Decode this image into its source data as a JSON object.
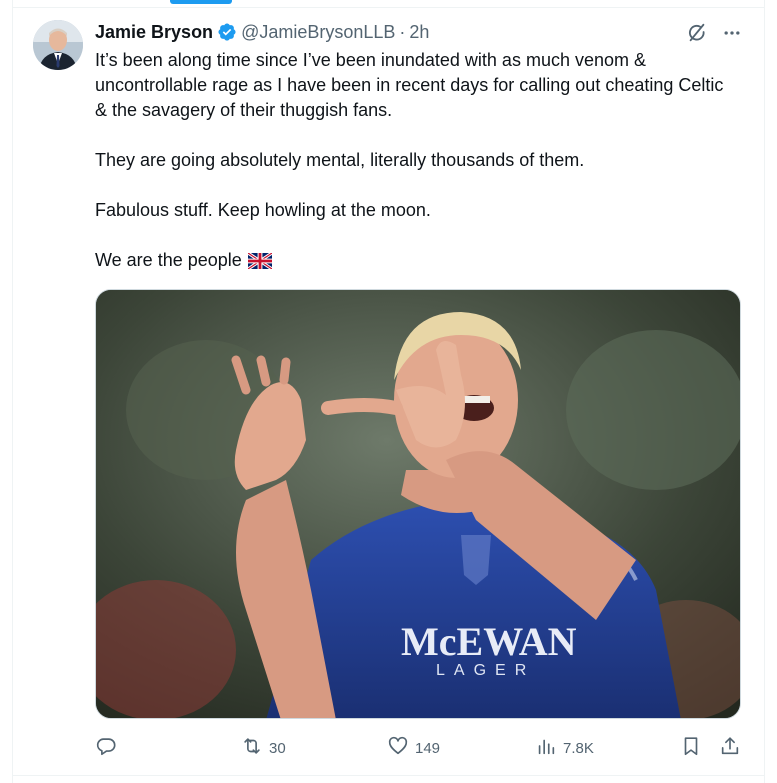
{
  "tweet": {
    "author": {
      "display_name": "Jamie Bryson",
      "handle": "@JamieBrysonLLB",
      "verified": true
    },
    "separator": "·",
    "time": "2h",
    "paragraphs": [
      "It’s been along time since I’ve been inundated with as much venom & uncontrollable rage as I have been in recent days for calling out cheating Celtic & the savagery of their thuggish fans.",
      "They are going absolutely mental, literally thousands of them.",
      "Fabulous stuff. Keep howling at the moon.",
      "We are the people"
    ],
    "flag_emoji": "union-jack-flag-icon",
    "image_text": {
      "line1": "McEWAN",
      "line2": "LAGER"
    },
    "metrics": {
      "replies": "",
      "retweets": "30",
      "likes": "149",
      "views": "7.8K"
    }
  },
  "icons": {
    "verified": "verified-badge-icon",
    "grok": "grok-icon",
    "more": "more-icon",
    "reply": "reply-icon",
    "retweet": "retweet-icon",
    "like": "heart-icon",
    "views": "views-icon",
    "bookmark": "bookmark-icon",
    "share": "share-icon"
  },
  "colors": {
    "accent": "#1d9bf0",
    "text": "#0f1419",
    "secondary": "#536471",
    "border": "#eff3f4"
  }
}
